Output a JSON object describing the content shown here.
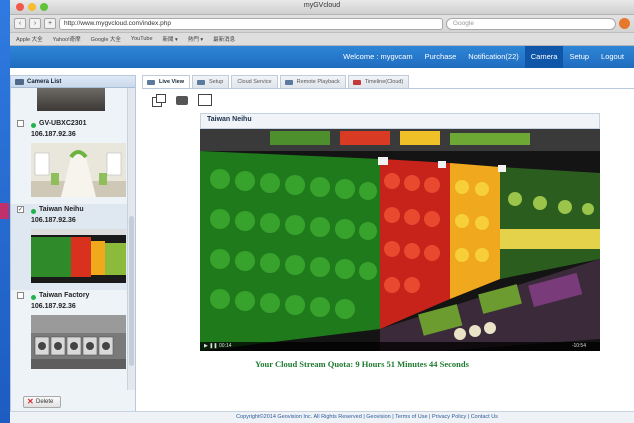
{
  "browser": {
    "window_title": "myGVcloud",
    "url": "http://www.mygvcloud.com/index.php",
    "search_placeholder": "Google",
    "bookmarks": [
      "Apple 大全",
      "Yahoo!奇摩",
      "Google 大全",
      "YouTube",
      "新聞 ▾",
      "熱門 ▾",
      "最新消息"
    ]
  },
  "site_nav": {
    "welcome": "Welcome : mygvcam",
    "items": [
      "Purchase",
      "Notification(22)",
      "Camera",
      "Setup",
      "Logout"
    ],
    "active": "Camera"
  },
  "sidebar": {
    "title": "Camera List",
    "cameras": [
      {
        "name": "GV-UBXC2301",
        "ip": "106.187.92.36",
        "checked": false
      },
      {
        "name": "Taiwan Neihu",
        "ip": "106.187.92.36",
        "checked": true
      },
      {
        "name": "Taiwan Factory",
        "ip": "106.187.92.36",
        "checked": false
      }
    ],
    "delete_label": "Delete"
  },
  "tabs": [
    "Live View",
    "Setup",
    "Cloud Service",
    "Remote Playback",
    "Timeline(Cloud)"
  ],
  "active_tab": "Live View",
  "viewer": {
    "camera_title": "Taiwan Neihu",
    "time_left": "00:14",
    "time_right": "-10:54"
  },
  "quota_text": "Your Cloud Stream Quota: 9 Hours 51 Minutes 44 Seconds",
  "footer_text": "Copyright©2014 Geovision Inc. All Rights Reserved | Geovision | Terms of Use | Privacy Policy | Contact Us",
  "colors": {
    "nav_blue": "#1f6cbf",
    "status_online": "#23b24b",
    "quota_green": "#1f7a30"
  }
}
